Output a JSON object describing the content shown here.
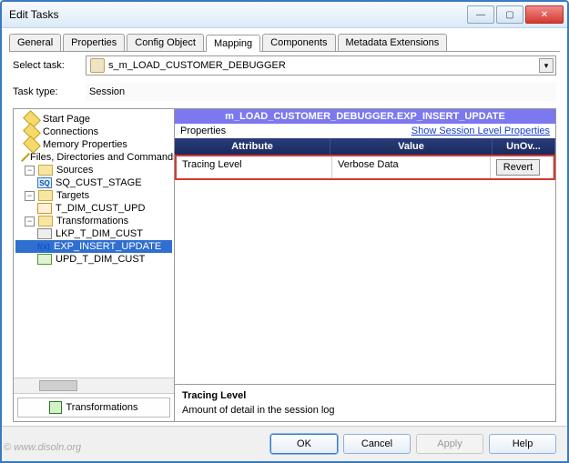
{
  "window": {
    "title": "Edit Tasks"
  },
  "winbtns": {
    "min": "—",
    "max": "▢",
    "close": "✕"
  },
  "tabs": [
    "General",
    "Properties",
    "Config Object",
    "Mapping",
    "Components",
    "Metadata Extensions"
  ],
  "activeTab": 3,
  "form": {
    "selectTaskLabel": "Select task:",
    "selectTaskValue": "s_m_LOAD_CUSTOMER_DEBUGGER",
    "taskTypeLabel": "Task type:",
    "taskTypeValue": "Session"
  },
  "tree": {
    "top": [
      "Start Page",
      "Connections",
      "Memory Properties",
      "Files, Directories and Commands"
    ],
    "sources": {
      "label": "Sources",
      "items": [
        "SQ_CUST_STAGE"
      ]
    },
    "targets": {
      "label": "Targets",
      "items": [
        "T_DIM_CUST_UPD"
      ]
    },
    "transforms": {
      "label": "Transformations",
      "items": [
        "LKP_T_DIM_CUST",
        "EXP_INSERT_UPDATE",
        "UPD_T_DIM_CUST"
      ]
    }
  },
  "leftTab": "Transformations",
  "right": {
    "path": "m_LOAD_CUSTOMER_DEBUGGER.EXP_INSERT_UPDATE",
    "propLabel": "Properties",
    "showLink": "Show Session Level Properties",
    "head": {
      "attr": "Attribute",
      "val": "Value",
      "un": "UnOv..."
    },
    "row": {
      "attr": "Tracing Level",
      "val": "Verbose Data",
      "revert": "Revert"
    },
    "desc": {
      "title": "Tracing Level",
      "body": "Amount of detail in the session log"
    }
  },
  "footer": {
    "ok": "OK",
    "cancel": "Cancel",
    "apply": "Apply",
    "help": "Help"
  },
  "watermark": "© www.disoln.org",
  "glyph": {
    "minus": "−",
    "sq": "SQ",
    "dd": "▾",
    "fx": "f(x)"
  }
}
